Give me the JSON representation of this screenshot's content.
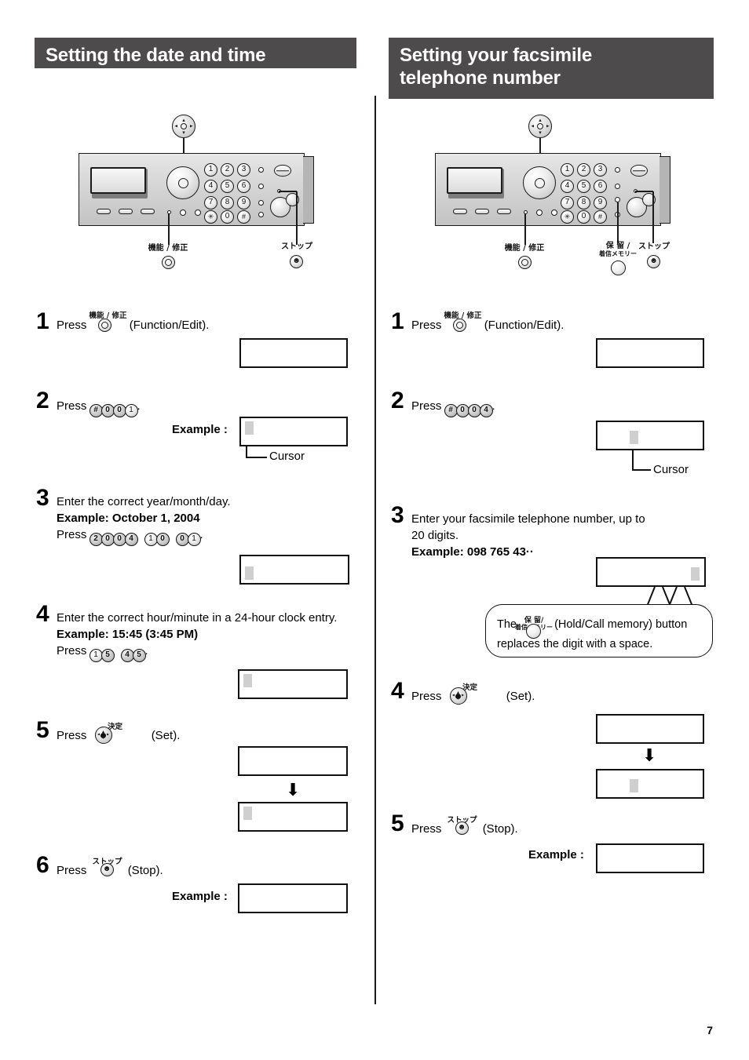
{
  "page": {
    "number": "7"
  },
  "left_section": {
    "title": "Setting the date and time",
    "figure": {
      "label_function_edit": "機能 / 修正",
      "label_stop": "ストップ",
      "dial_keys": [
        "1",
        "2",
        "3",
        "4",
        "5",
        "6",
        "7",
        "8",
        "9",
        "✳",
        "0",
        "#"
      ]
    },
    "steps": [
      {
        "number": "1",
        "press_word": "Press",
        "key_jp": "機能 / 修正",
        "key_en": "(Function/Edit).",
        "display": {
          "text": "",
          "cursor": false
        }
      },
      {
        "number": "2",
        "press_word": "Press",
        "keys": [
          "#",
          "0",
          "0",
          "1"
        ],
        "trailing": ".",
        "example_label": "Example :",
        "cursor_label": "Cursor",
        "display": {
          "text": "",
          "cursor": true
        }
      },
      {
        "number": "3",
        "line1": "Enter the correct year/month/day.",
        "line2": "Example: October 1, 2004",
        "press_word": "Press",
        "key_groups": [
          [
            "2",
            "0",
            "0",
            "4"
          ],
          [
            "1",
            "0"
          ],
          [
            "0",
            "1"
          ]
        ],
        "trailing": ".",
        "display": {
          "text": "",
          "cursor": true
        }
      },
      {
        "number": "4",
        "line1": "Enter the correct hour/minute in a 24-hour clock entry.",
        "line2": "Example: 15:45 (3:45 PM)",
        "press_word": "Press",
        "key_groups": [
          [
            "1",
            "5"
          ],
          [
            "4",
            "5"
          ]
        ],
        "trailing": ".",
        "display": {
          "text": "",
          "cursor": true
        }
      },
      {
        "number": "5",
        "press_word": "Press",
        "key_jp": "決定",
        "key_en": "(Set).",
        "display_1": {
          "text": "",
          "cursor": false
        },
        "display_2": {
          "text": "",
          "cursor": true
        }
      },
      {
        "number": "6",
        "press_word": "Press",
        "key_jp": "ストップ",
        "key_en": "(Stop).",
        "example_label": "Example :",
        "display": {
          "text": "",
          "cursor": false
        }
      }
    ]
  },
  "right_section": {
    "title_line1": "Setting your facsimile",
    "title_line2": "telephone number",
    "figure": {
      "label_function_edit": "機能 / 修正",
      "label_hold_line1": "保 留 /",
      "label_hold_line2": "着信メモリー",
      "label_stop": "ストップ",
      "dial_keys": [
        "1",
        "2",
        "3",
        "4",
        "5",
        "6",
        "7",
        "8",
        "9",
        "✳",
        "0",
        "#"
      ]
    },
    "steps": [
      {
        "number": "1",
        "press_word": "Press",
        "key_jp": "機能 / 修正",
        "key_en": "(Function/Edit).",
        "display": {
          "text": "",
          "cursor": false
        }
      },
      {
        "number": "2",
        "press_word": "Press",
        "keys": [
          "#",
          "0",
          "0",
          "4"
        ],
        "trailing": ".",
        "cursor_label": "Cursor",
        "display": {
          "text": "",
          "cursor": true
        }
      },
      {
        "number": "3",
        "line1": "Enter your facsimile telephone number, up to",
        "line2": "20 digits.",
        "line3": "Example: 098 765 43··",
        "display": {
          "text": "",
          "cursor": true
        },
        "balloon": {
          "prefix": "The",
          "key_jp_line1": "保 留/",
          "key_jp_line2": "着信メモリー",
          "middle": "(Hold/Call memory) button",
          "line2": "replaces the digit with a space."
        }
      },
      {
        "number": "4",
        "press_word": "Press",
        "key_jp": "決定",
        "key_en": "(Set).",
        "display_1": {
          "text": "",
          "cursor": false
        },
        "display_2": {
          "text": "",
          "cursor": true
        }
      },
      {
        "number": "5",
        "press_word": "Press",
        "key_jp": "ストップ",
        "key_en": "(Stop).",
        "example_label": "Example :",
        "display": {
          "text": "",
          "cursor": false
        }
      }
    ]
  },
  "colors": {
    "header_bg": "#4d4b4b",
    "header_text": "#ffffff",
    "cursor_block": "#cfcfcf",
    "panel_body": "#d2d2d2"
  }
}
